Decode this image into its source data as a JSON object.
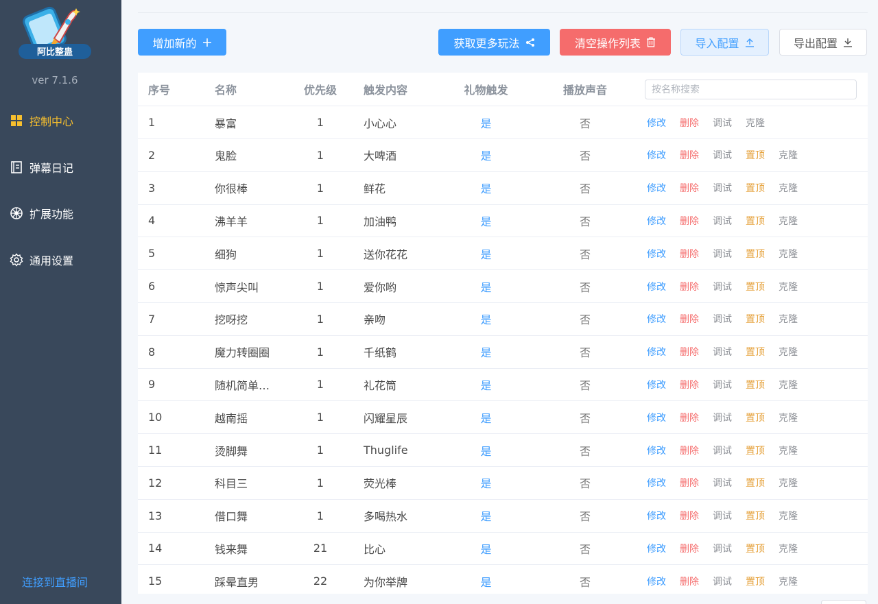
{
  "app": {
    "logo_text": "阿比整蛊",
    "version": "ver 7.1.6",
    "accent": "#f7bf2e"
  },
  "sidebar": {
    "items": [
      {
        "label": "控制中心",
        "icon": "grid-icon",
        "active": true
      },
      {
        "label": "弹幕日记",
        "icon": "notebook-icon",
        "active": false
      },
      {
        "label": "扩展功能",
        "icon": "wheel-icon",
        "active": false
      },
      {
        "label": "通用设置",
        "icon": "gear-icon",
        "active": false
      }
    ],
    "connect_label": "连接到直播间"
  },
  "toolbar": {
    "add_label": "增加新的",
    "more_label": "获取更多玩法",
    "clear_label": "清空操作列表",
    "import_label": "导入配置",
    "export_label": "导出配置"
  },
  "table": {
    "headers": {
      "index": "序号",
      "name": "名称",
      "priority": "优先级",
      "trigger": "触发内容",
      "gift": "礼物触发",
      "sound": "播放声音"
    },
    "search_placeholder": "按名称搜索",
    "actions": {
      "edit": "修改",
      "delete": "删除",
      "debug": "调试",
      "top": "置顶",
      "clone": "克隆"
    },
    "rows": [
      {
        "index": "1",
        "name": "暴富",
        "priority": "1",
        "trigger": "小心心",
        "gift": "是",
        "sound": "否",
        "show_top": false
      },
      {
        "index": "2",
        "name": "鬼脸",
        "priority": "1",
        "trigger": "大啤酒",
        "gift": "是",
        "sound": "否",
        "show_top": true
      },
      {
        "index": "3",
        "name": "你很棒",
        "priority": "1",
        "trigger": "鲜花",
        "gift": "是",
        "sound": "否",
        "show_top": true
      },
      {
        "index": "4",
        "name": "沸羊羊",
        "priority": "1",
        "trigger": "加油鸭",
        "gift": "是",
        "sound": "否",
        "show_top": true
      },
      {
        "index": "5",
        "name": "细狗",
        "priority": "1",
        "trigger": "送你花花",
        "gift": "是",
        "sound": "否",
        "show_top": true
      },
      {
        "index": "6",
        "name": "惊声尖叫",
        "priority": "1",
        "trigger": "爱你哟",
        "gift": "是",
        "sound": "否",
        "show_top": true
      },
      {
        "index": "7",
        "name": "挖呀挖",
        "priority": "1",
        "trigger": "亲吻",
        "gift": "是",
        "sound": "否",
        "show_top": true
      },
      {
        "index": "8",
        "name": "魔力转圈圈",
        "priority": "1",
        "trigger": "千纸鹤",
        "gift": "是",
        "sound": "否",
        "show_top": true
      },
      {
        "index": "9",
        "name": "随机简单…",
        "priority": "1",
        "trigger": "礼花筒",
        "gift": "是",
        "sound": "否",
        "show_top": true
      },
      {
        "index": "10",
        "name": "越南摇",
        "priority": "1",
        "trigger": "闪耀星辰",
        "gift": "是",
        "sound": "否",
        "show_top": true
      },
      {
        "index": "11",
        "name": "烫脚舞",
        "priority": "1",
        "trigger": "Thuglife",
        "gift": "是",
        "sound": "否",
        "show_top": true
      },
      {
        "index": "12",
        "name": "科目三",
        "priority": "1",
        "trigger": "荧光棒",
        "gift": "是",
        "sound": "否",
        "show_top": true
      },
      {
        "index": "13",
        "name": "借口舞",
        "priority": "1",
        "trigger": "多喝热水",
        "gift": "是",
        "sound": "否",
        "show_top": true
      },
      {
        "index": "14",
        "name": "钱来舞",
        "priority": "21",
        "trigger": "比心",
        "gift": "是",
        "sound": "否",
        "show_top": true
      },
      {
        "index": "15",
        "name": "踩晕直男",
        "priority": "22",
        "trigger": "为你举牌",
        "gift": "是",
        "sound": "否",
        "show_top": true
      }
    ]
  }
}
